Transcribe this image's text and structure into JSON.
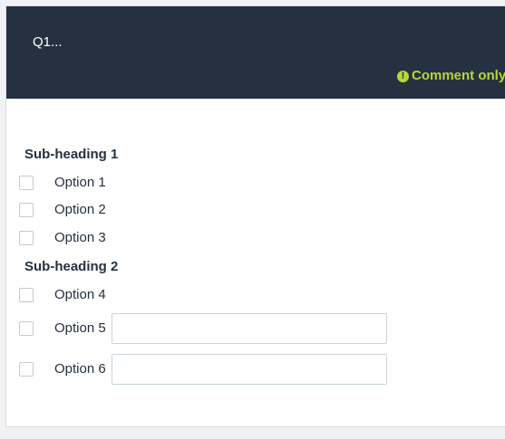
{
  "question": {
    "title": "Q1...",
    "comment_note": "Comment only w",
    "warning_icon": "!"
  },
  "groups": [
    {
      "subheading": "Sub-heading 1",
      "options": [
        {
          "label": "Option 1"
        },
        {
          "label": "Option 2"
        },
        {
          "label": "Option 3"
        }
      ]
    },
    {
      "subheading": "Sub-heading 2",
      "options": [
        {
          "label": "Option 4"
        },
        {
          "label": "Option 5",
          "text_value": ""
        },
        {
          "label": "Option 6",
          "text_value": ""
        }
      ]
    }
  ],
  "colors": {
    "header_bg": "#253140",
    "accent": "#bad536",
    "text": "#253140"
  }
}
